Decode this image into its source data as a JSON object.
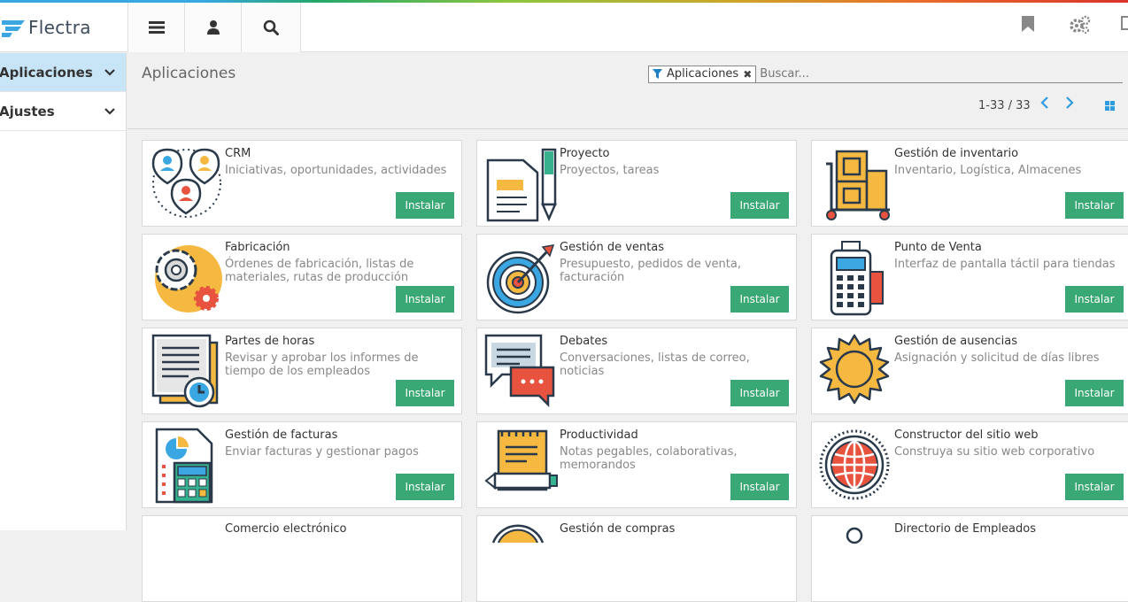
{
  "brand": {
    "logo_text": "Flectra"
  },
  "sidebar": {
    "items": [
      {
        "label": "Aplicaciones",
        "active": true
      },
      {
        "label": "Ajustes",
        "active": false
      }
    ]
  },
  "control": {
    "title": "Aplicaciones",
    "facet_label": "Aplicaciones",
    "search_placeholder": "Buscar...",
    "pager_text": "1-33 / 33"
  },
  "apps": [
    {
      "name": "CRM",
      "desc": "Iniciativas, oportunidades, actividades",
      "button": "Instalar",
      "icon": "crm-icon"
    },
    {
      "name": "Proyecto",
      "desc": "Proyectos, tareas",
      "button": "Instalar",
      "icon": "project-icon"
    },
    {
      "name": "Gestión de inventario",
      "desc": "Inventario, Logística, Almacenes",
      "button": "Instalar",
      "icon": "inventory-icon"
    },
    {
      "name": "Fabricación",
      "desc": "Órdenes de fabricación, listas de materiales, rutas de producción",
      "button": "Instalar",
      "icon": "manufacturing-icon"
    },
    {
      "name": "Gestión de ventas",
      "desc": "Presupuesto, pedidos de venta, facturación",
      "button": "Instalar",
      "icon": "sales-icon"
    },
    {
      "name": "Punto de Venta",
      "desc": "Interfaz de pantalla táctil para tiendas",
      "button": "Instalar",
      "icon": "pos-icon"
    },
    {
      "name": "Partes de horas",
      "desc": "Revisar y aprobar los informes de tiempo de los empleados",
      "button": "Instalar",
      "icon": "timesheet-icon"
    },
    {
      "name": "Debates",
      "desc": "Conversaciones, listas de correo, noticias",
      "button": "Instalar",
      "icon": "discuss-icon"
    },
    {
      "name": "Gestión de ausencias",
      "desc": "Asignación y solicitud de días libres",
      "button": "Instalar",
      "icon": "leaves-icon"
    },
    {
      "name": "Gestión de facturas",
      "desc": "Enviar facturas y gestionar pagos",
      "button": "Instalar",
      "icon": "invoicing-icon"
    },
    {
      "name": "Productividad",
      "desc": "Notas pegables, colaborativas, memorandos",
      "button": "Instalar",
      "icon": "notes-icon"
    },
    {
      "name": "Constructor del sitio web",
      "desc": "Construya su sitio web corporativo",
      "button": "Instalar",
      "icon": "website-icon"
    },
    {
      "name": "Comercio electrónico",
      "desc": "",
      "button": "",
      "icon": "ecommerce-icon"
    },
    {
      "name": "Gestión de compras",
      "desc": "",
      "button": "",
      "icon": "purchase-icon"
    },
    {
      "name": "Directorio de Empleados",
      "desc": "",
      "button": "",
      "icon": "employees-icon"
    }
  ],
  "colors": {
    "install_button": "#3aa874",
    "active_sidebar": "#c8e5f7",
    "accent": "#3aa7e3"
  }
}
